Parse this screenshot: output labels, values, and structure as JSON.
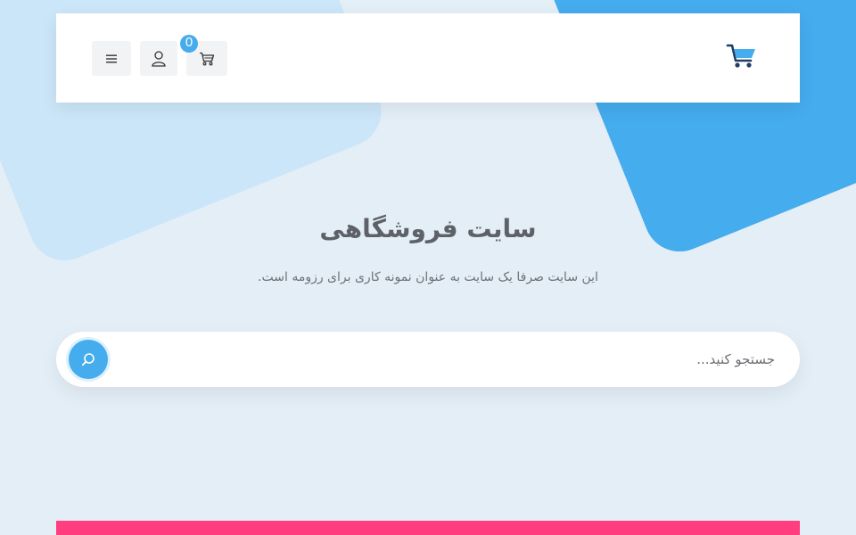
{
  "header": {
    "cart_count": "0",
    "icons": {
      "menu": "hamburger-menu-icon",
      "user": "user-icon",
      "cart": "shopping-cart-icon",
      "logo": "shopping-cart-logo"
    }
  },
  "hero": {
    "title": "سایت فروشگاهی",
    "subtitle": "این سایت صرفا یک سایت به عنوان نمونه کاری برای رزومه است."
  },
  "search": {
    "placeholder": "جستجو کنید...",
    "value": ""
  },
  "colors": {
    "background": "#e4eef6",
    "accent_blue": "#45aced",
    "light_blue": "#cbe6f8",
    "pink": "#ff3d7f",
    "header_bg": "#ffffff"
  }
}
